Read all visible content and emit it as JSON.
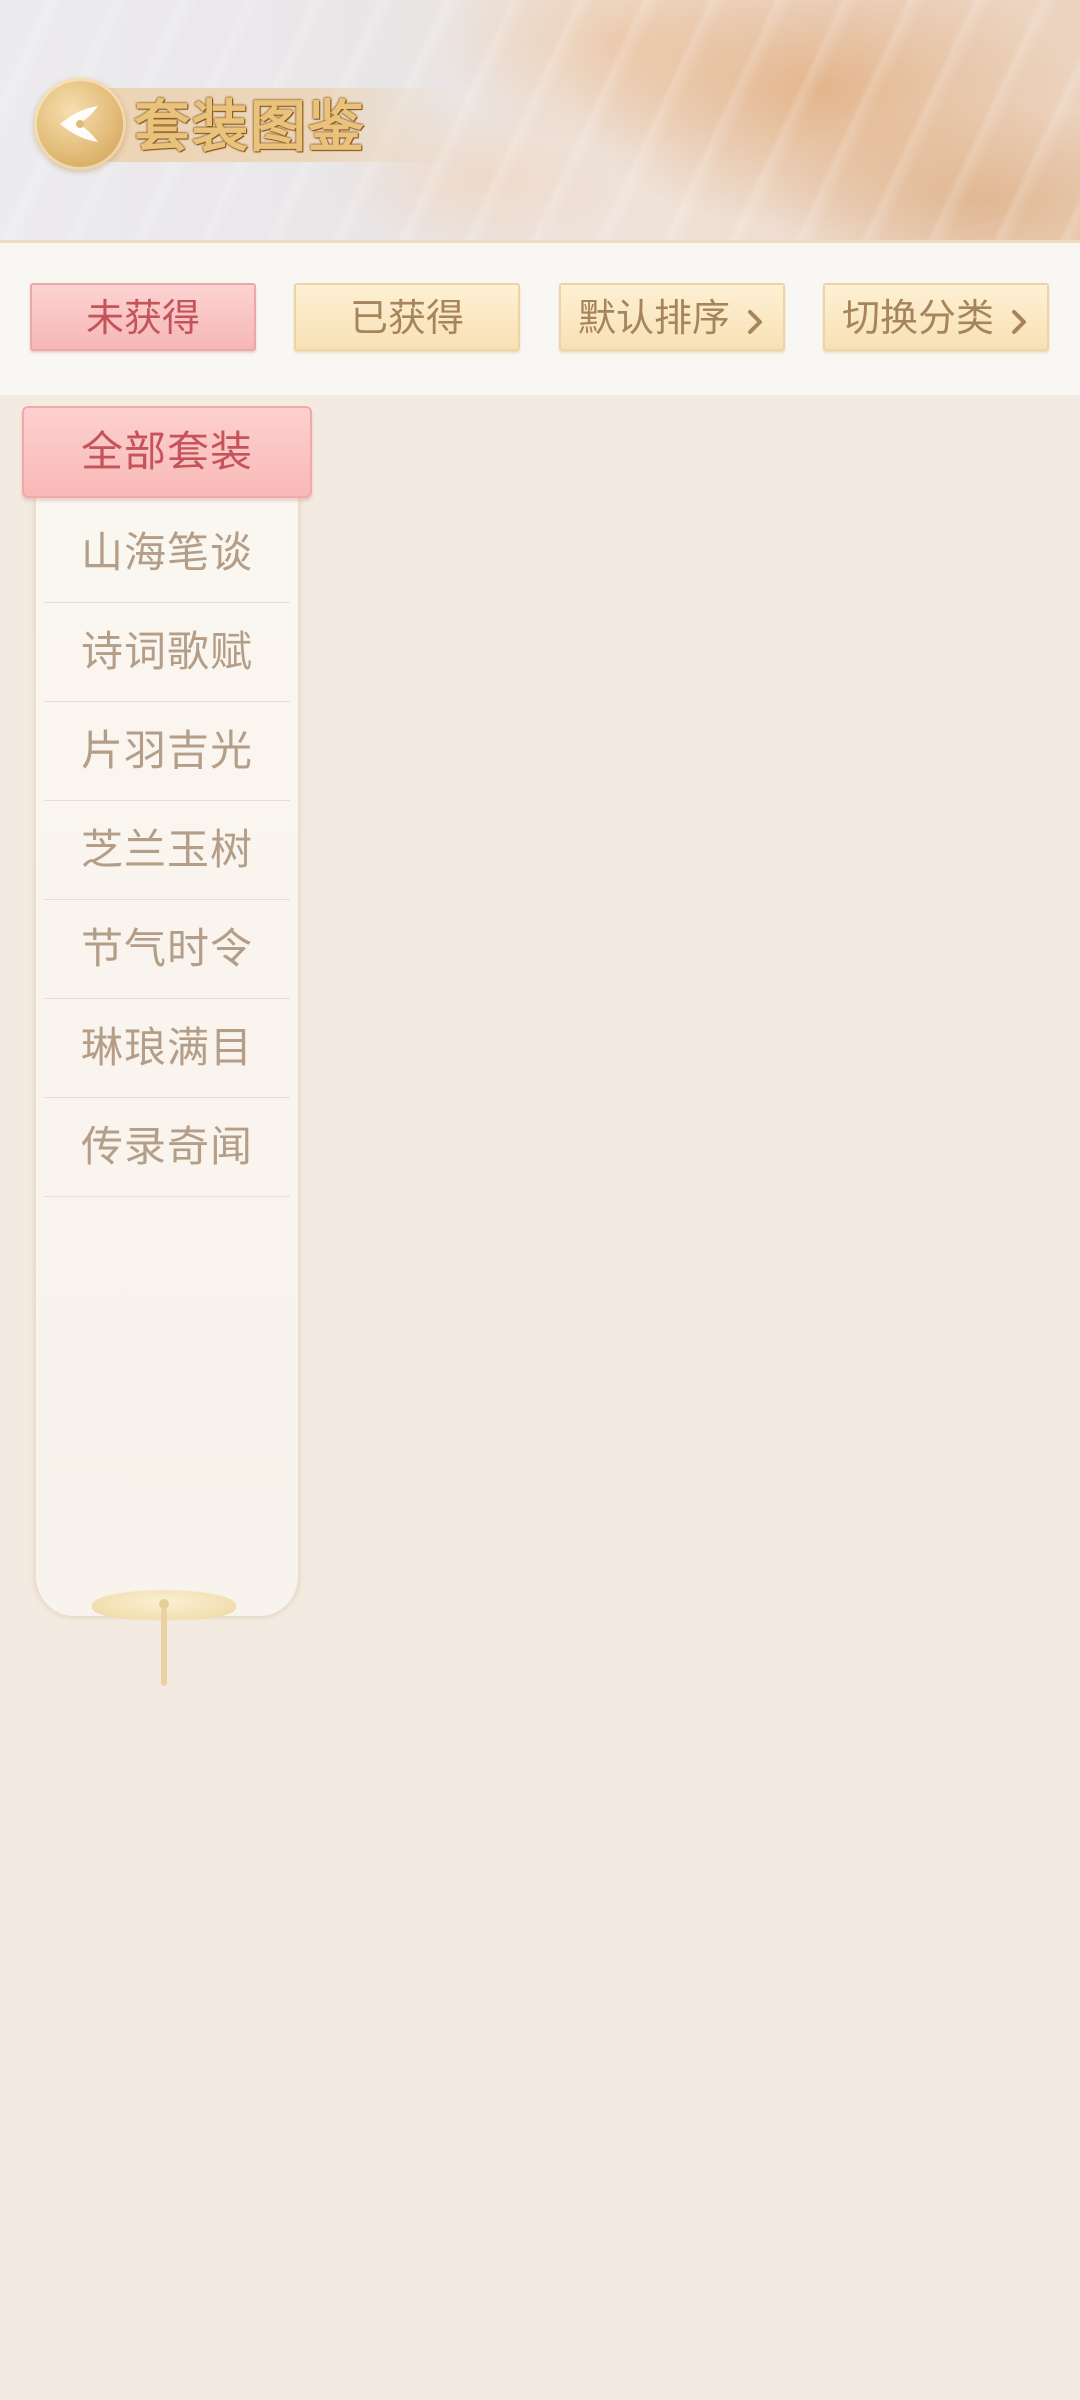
{
  "header": {
    "title": "套装图鉴",
    "back_icon": "leaf-back-icon"
  },
  "filters": {
    "not_obtained": "未获得",
    "obtained": "已获得",
    "sort": "默认排序",
    "switch_category": "切换分类",
    "chevron_icon": "chevron-right-icon"
  },
  "categories": {
    "active": "全部套装",
    "items": [
      "山海笔谈",
      "诗词歌赋",
      "片羽吉光",
      "芝兰玉树",
      "节气时令",
      "琳琅满目",
      "传录奇闻"
    ]
  },
  "colors": {
    "background": "#f3ebe1",
    "accent_pink": "#f8b9b7",
    "accent_gold": "#f8e1b4",
    "text_pink": "#c4535a",
    "text_gold": "#a6845c",
    "text_muted": "#b49e88"
  }
}
